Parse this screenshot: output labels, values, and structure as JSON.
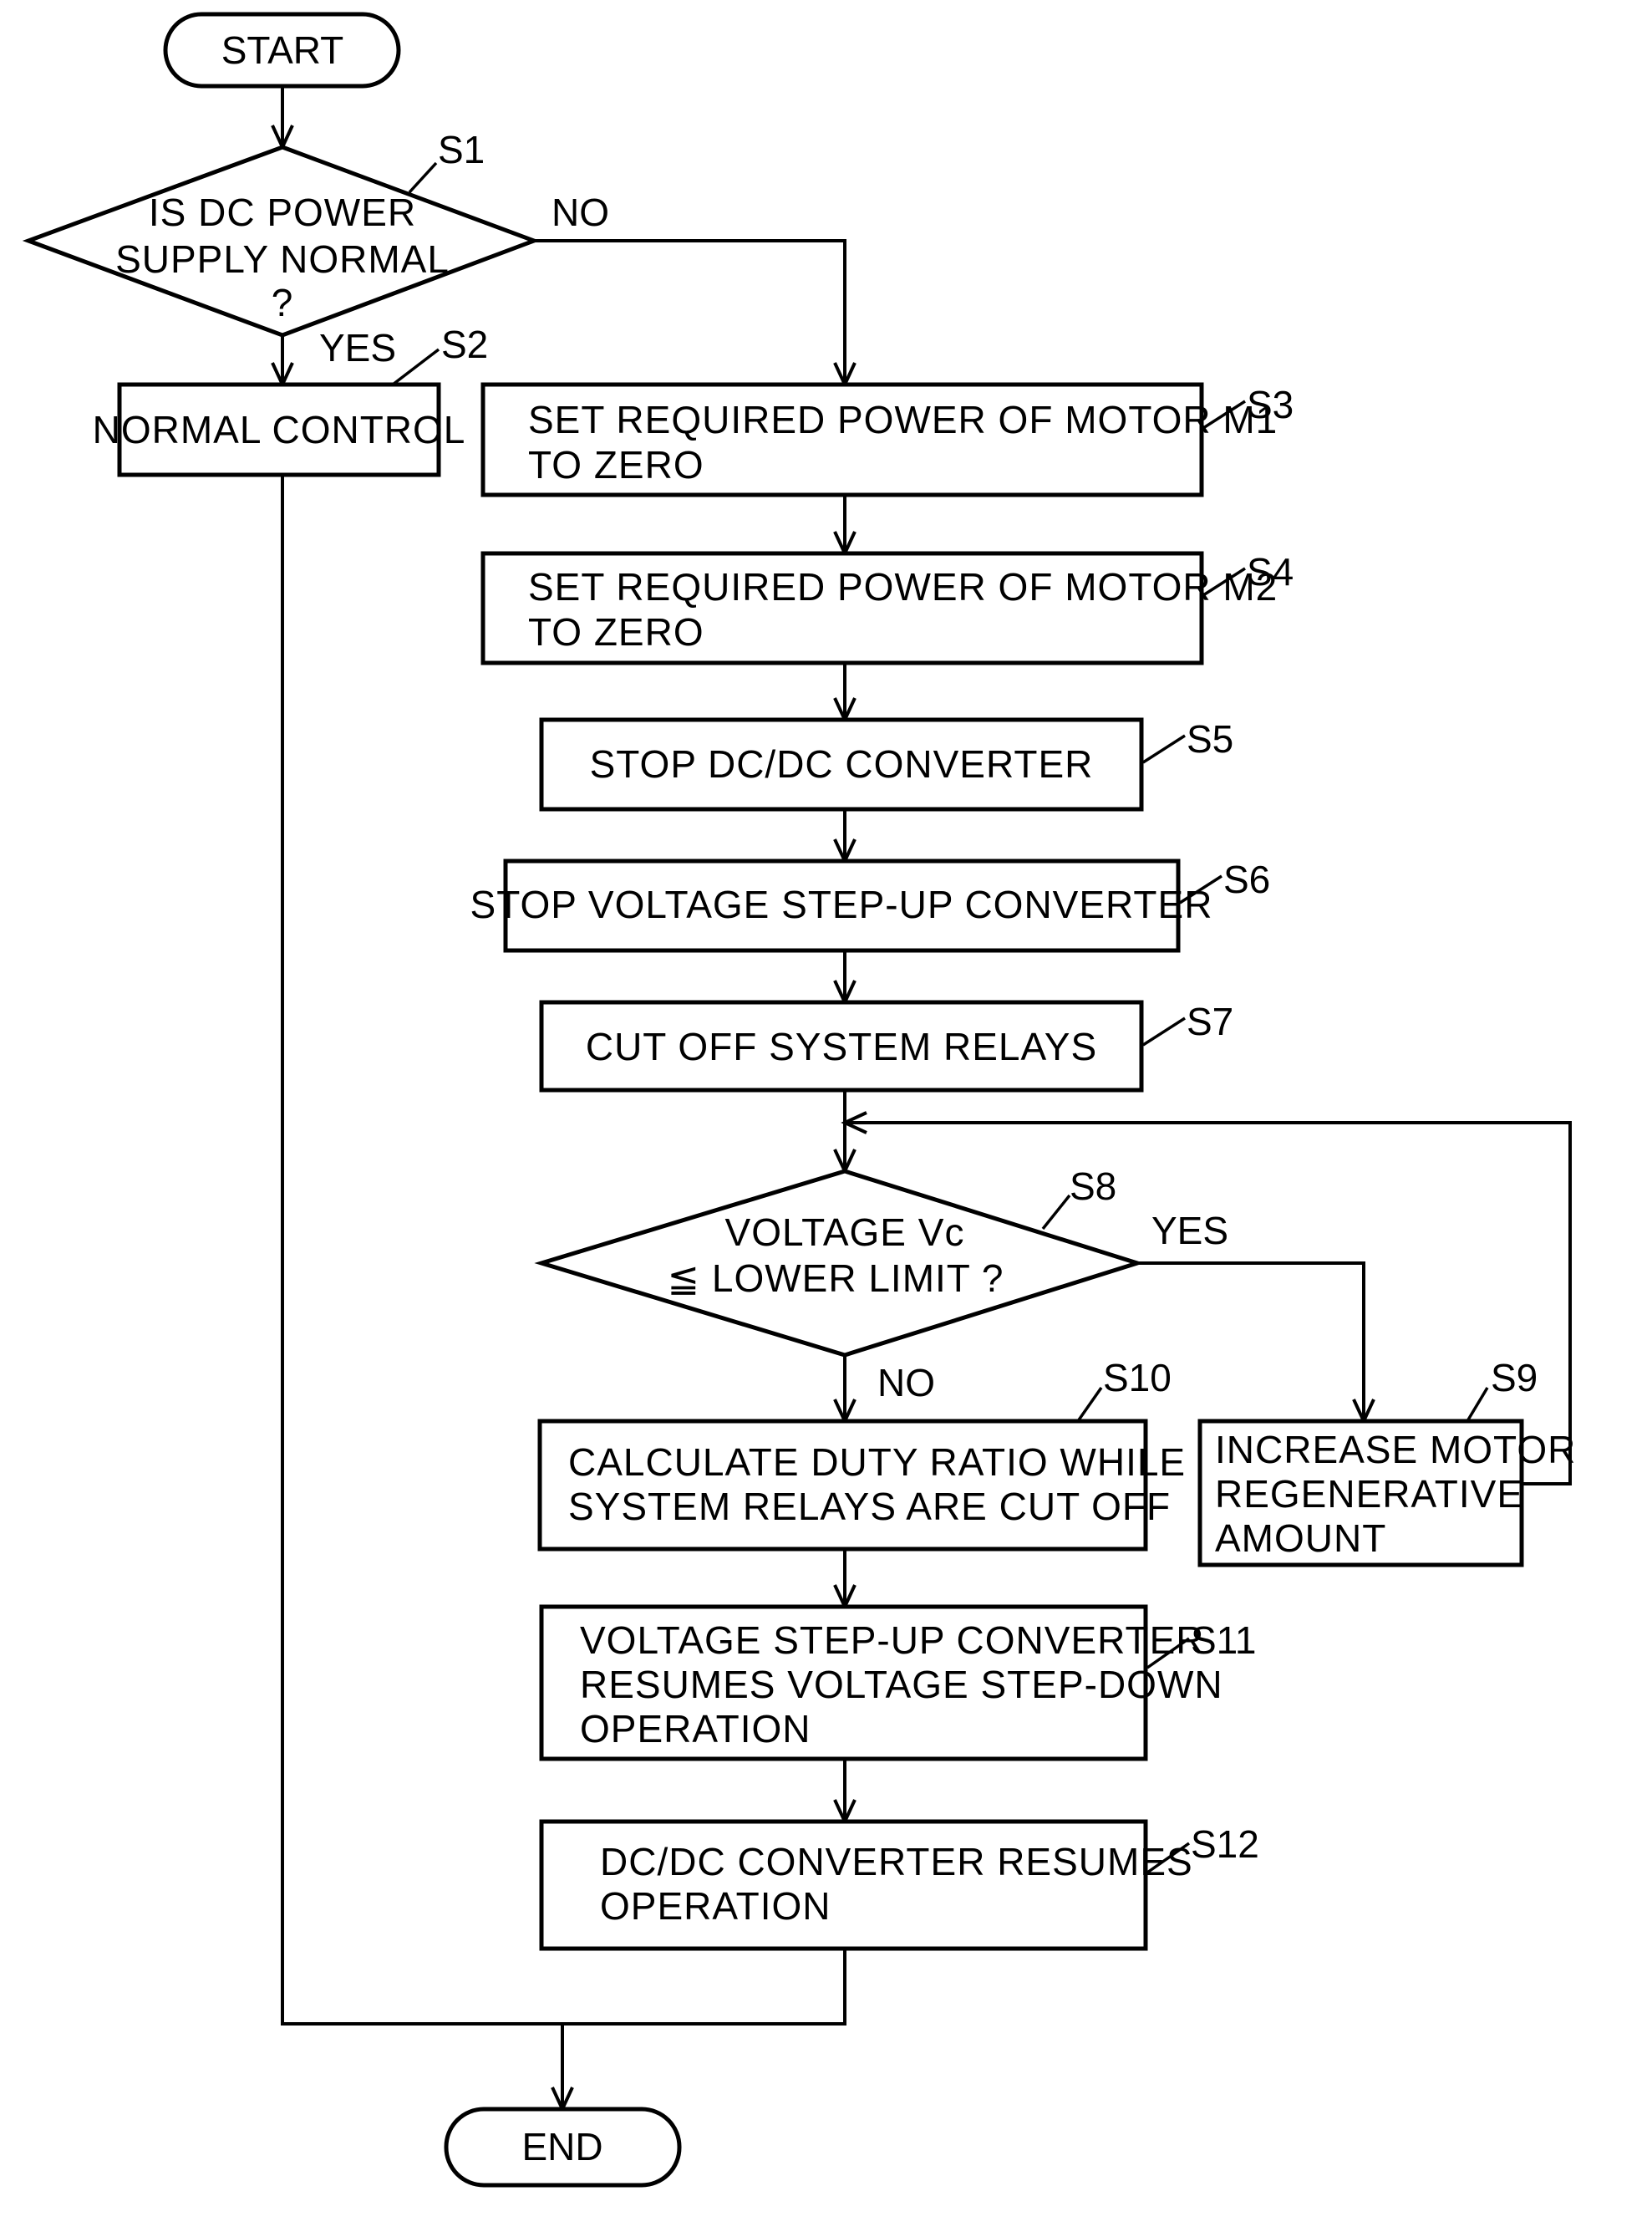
{
  "diagram": {
    "type": "flowchart",
    "start": "START",
    "end": "END",
    "steps": {
      "s1": {
        "id": "S1",
        "kind": "decision",
        "lines": [
          "IS DC POWER",
          "SUPPLY NORMAL",
          "?"
        ],
        "yes": "YES",
        "no": "NO"
      },
      "s2": {
        "id": "S2",
        "kind": "process",
        "lines": [
          "NORMAL CONTROL"
        ]
      },
      "s3": {
        "id": "S3",
        "kind": "process",
        "lines": [
          "SET REQUIRED POWER OF MOTOR M1",
          "TO ZERO"
        ]
      },
      "s4": {
        "id": "S4",
        "kind": "process",
        "lines": [
          "SET REQUIRED POWER OF MOTOR M2",
          "TO ZERO"
        ]
      },
      "s5": {
        "id": "S5",
        "kind": "process",
        "lines": [
          "STOP DC/DC CONVERTER"
        ]
      },
      "s6": {
        "id": "S6",
        "kind": "process",
        "lines": [
          "STOP VOLTAGE STEP-UP CONVERTER"
        ]
      },
      "s7": {
        "id": "S7",
        "kind": "process",
        "lines": [
          "CUT OFF SYSTEM RELAYS"
        ]
      },
      "s8": {
        "id": "S8",
        "kind": "decision",
        "lines": [
          "VOLTAGE Vc",
          "≦ LOWER LIMIT ?"
        ],
        "yes": "YES",
        "no": "NO"
      },
      "s9": {
        "id": "S9",
        "kind": "process",
        "lines": [
          "INCREASE MOTOR",
          "REGENERATIVE",
          "AMOUNT"
        ]
      },
      "s10": {
        "id": "S10",
        "kind": "process",
        "lines": [
          "CALCULATE DUTY RATIO WHILE",
          "SYSTEM RELAYS ARE CUT OFF"
        ]
      },
      "s11": {
        "id": "S11",
        "kind": "process",
        "lines": [
          "VOLTAGE STEP-UP CONVERTER",
          "RESUMES VOLTAGE STEP-DOWN",
          "OPERATION"
        ]
      },
      "s12": {
        "id": "S12",
        "kind": "process",
        "lines": [
          "DC/DC CONVERTER RESUMES",
          "OPERATION"
        ]
      }
    },
    "edges": [
      {
        "from": "START",
        "to": "S1"
      },
      {
        "from": "S1",
        "to": "S2",
        "label": "YES"
      },
      {
        "from": "S1",
        "to": "S3",
        "label": "NO"
      },
      {
        "from": "S3",
        "to": "S4"
      },
      {
        "from": "S4",
        "to": "S5"
      },
      {
        "from": "S5",
        "to": "S6"
      },
      {
        "from": "S6",
        "to": "S7"
      },
      {
        "from": "S7",
        "to": "S8"
      },
      {
        "from": "S8",
        "to": "S9",
        "label": "YES"
      },
      {
        "from": "S9",
        "to": "S8"
      },
      {
        "from": "S8",
        "to": "S10",
        "label": "NO"
      },
      {
        "from": "S10",
        "to": "S11"
      },
      {
        "from": "S11",
        "to": "S12"
      },
      {
        "from": "S12",
        "to": "END"
      },
      {
        "from": "S2",
        "to": "END"
      }
    ]
  }
}
